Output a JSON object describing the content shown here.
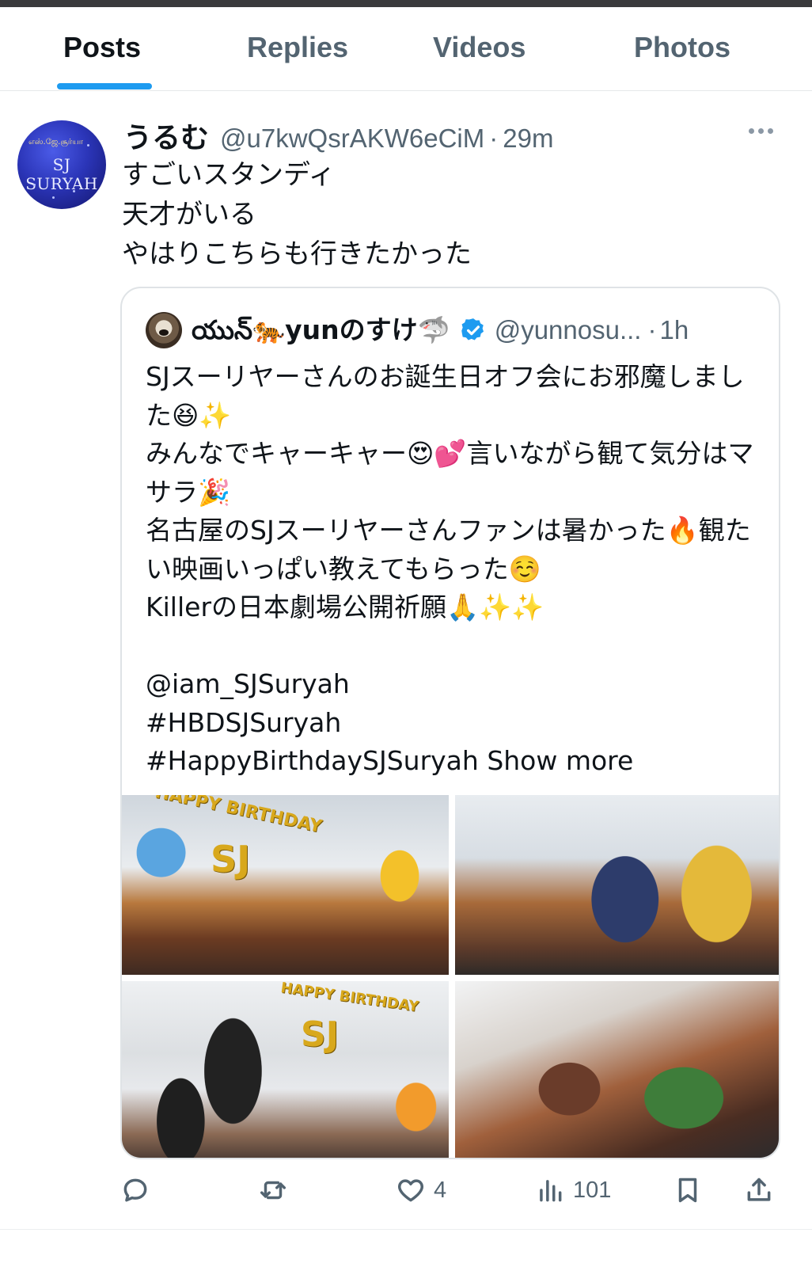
{
  "tabs": [
    "Posts",
    "Replies",
    "Videos",
    "Photos"
  ],
  "post": {
    "author_name": "うるむ",
    "author_handle": "@u7kwQsrAKW6eCiM",
    "separator": "·",
    "time": "29m",
    "avatar_text": "SJ SURYAH",
    "avatar_tamil": "எஸ்.ஜே.சூர்யா",
    "text": "すごいスタンディ\n天才がいる\nやはりこちらも行きたかった"
  },
  "quote": {
    "author_name": "యున్🐅yunのすけ🦈",
    "author_handle": "@yunnosu...",
    "separator": "·",
    "time": "1h",
    "text": "SJスーリヤーさんのお誕生日オフ会にお邪魔しました😆✨\nみんなでキャーキャー😍💕言いながら観て気分はマサラ🎉\n名古屋のSJスーリヤーさんファンは暑かった🔥観たい映画いっぱい教えてもらった☺️\nKillerの日本劇場公開祈願🙏✨✨\n\n@iam_SJSuryah\n#HBDSJSuryah\n#HappyBirthdaySJSuryah ",
    "show_more": "Show more",
    "photo_texts": [
      "HAPPY BIRTHDAY",
      "SJ",
      "HAPPY BIRTHDAY",
      "SJ"
    ]
  },
  "actions": {
    "reply_count": "",
    "repost_count": "",
    "like_count": "4",
    "views_count": "101"
  },
  "colors": {
    "accent": "#1d9bf0",
    "text_primary": "#0f1419",
    "text_secondary": "#536471",
    "border": "#dfe3e6"
  },
  "icons": {
    "more": "more-dots-icon",
    "verified": "verified-badge-icon",
    "reply": "reply-bubble-icon",
    "repost": "repost-icon",
    "like": "heart-icon",
    "views": "views-chart-icon",
    "bookmark": "bookmark-icon",
    "share": "share-upload-icon"
  }
}
